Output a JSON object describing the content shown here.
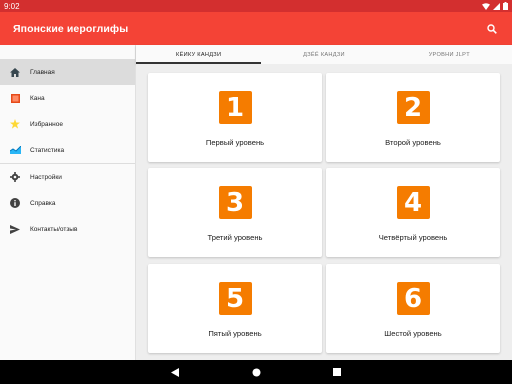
{
  "status_bar": {
    "time": "9:02"
  },
  "app_bar": {
    "title": "Японские иероглифы",
    "search_icon": "search-icon"
  },
  "sidebar": {
    "items": [
      {
        "label": "Главная",
        "icon": "home-icon",
        "active": true
      },
      {
        "label": "Кана",
        "icon": "kana-square-icon"
      },
      {
        "label": "Избранное",
        "icon": "star-icon"
      },
      {
        "label": "Статистика",
        "icon": "chart-icon"
      },
      {
        "label": "Настройки",
        "icon": "gear-icon"
      },
      {
        "label": "Справка",
        "icon": "info-icon"
      },
      {
        "label": "Контакты/отзыв",
        "icon": "send-icon"
      }
    ]
  },
  "tabs": [
    {
      "label": "КЁИКУ КАНДЗИ",
      "active": true
    },
    {
      "label": "ДЗЁЁ КАНДЗИ"
    },
    {
      "label": "УРОВНИ JLPT"
    }
  ],
  "levels": [
    {
      "number": "1",
      "label": "Первый уровень"
    },
    {
      "number": "2",
      "label": "Второй уровень"
    },
    {
      "number": "3",
      "label": "Третий уровень"
    },
    {
      "number": "4",
      "label": "Четвёртый уровень"
    },
    {
      "number": "5",
      "label": "Пятый уровень"
    },
    {
      "number": "6",
      "label": "Шестой уровень"
    }
  ],
  "colors": {
    "app_bar": "#f44336",
    "status_bar": "#d32f2f",
    "badge": "#f57c00"
  }
}
